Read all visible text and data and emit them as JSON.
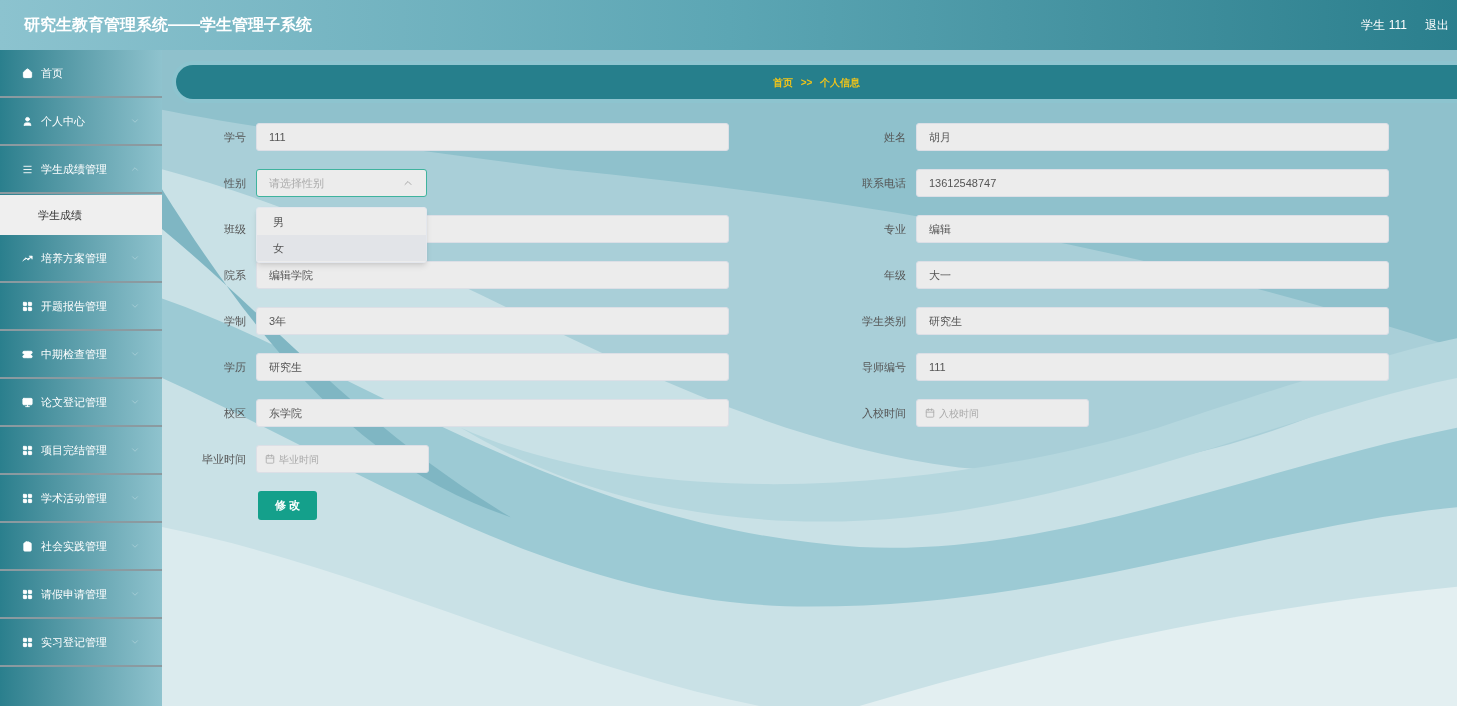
{
  "header": {
    "title": "研究生教育管理系统——学生管理子系统",
    "user": "学生 111",
    "logout": "退出"
  },
  "sidebar": {
    "items": [
      {
        "label": "首页",
        "selected": false
      },
      {
        "label": "个人中心",
        "selected": false,
        "expanded": false
      },
      {
        "label": "学生成绩管理",
        "selected": false,
        "expanded": true,
        "children": [
          {
            "label": "学生成绩",
            "selected": true
          }
        ]
      },
      {
        "label": "培养方案管理",
        "selected": false,
        "expanded": false
      },
      {
        "label": "开题报告管理",
        "selected": false,
        "expanded": false
      },
      {
        "label": "中期检查管理",
        "selected": false,
        "expanded": false
      },
      {
        "label": "论文登记管理",
        "selected": false,
        "expanded": false
      },
      {
        "label": "项目完结管理",
        "selected": false,
        "expanded": false
      },
      {
        "label": "学术活动管理",
        "selected": false,
        "expanded": false
      },
      {
        "label": "社会实践管理",
        "selected": false,
        "expanded": false
      },
      {
        "label": "请假申请管理",
        "selected": false,
        "expanded": false
      },
      {
        "label": "实习登记管理",
        "selected": false,
        "expanded": false
      }
    ]
  },
  "breadcrumb": {
    "home": "首页",
    "separator": ">>",
    "current": "个人信息"
  },
  "form": {
    "left": [
      {
        "kind": "text",
        "label": "学号",
        "value": "111"
      },
      {
        "kind": "select",
        "label": "性别",
        "placeholder": "请选择性别",
        "expanded": true,
        "options": [
          {
            "label": "男",
            "highlighted": false
          },
          {
            "label": "女",
            "highlighted": true
          }
        ]
      },
      {
        "kind": "text",
        "label": "班级"
      },
      {
        "kind": "text",
        "label": "院系",
        "value": "编辑学院"
      },
      {
        "kind": "text",
        "label": "学制",
        "value": "3年"
      },
      {
        "kind": "text",
        "label": "学历",
        "value": "研究生"
      },
      {
        "kind": "text",
        "label": "校区",
        "value": "东学院"
      },
      {
        "kind": "date",
        "label": "毕业时间",
        "placeholder": "毕业时间"
      }
    ],
    "right": [
      {
        "kind": "text",
        "label": "姓名",
        "value": "胡月"
      },
      {
        "kind": "text",
        "label": "联系电话",
        "value": "13612548747"
      },
      {
        "kind": "text",
        "label": "专业",
        "value": "编辑"
      },
      {
        "kind": "text",
        "label": "年级",
        "value": "大一"
      },
      {
        "kind": "text",
        "label": "学生类别",
        "value": "研究生"
      },
      {
        "kind": "text",
        "label": "导师编号",
        "value": "111"
      },
      {
        "kind": "date",
        "label": "入校时间",
        "placeholder": "入校时间"
      }
    ],
    "submit": "修 改"
  }
}
